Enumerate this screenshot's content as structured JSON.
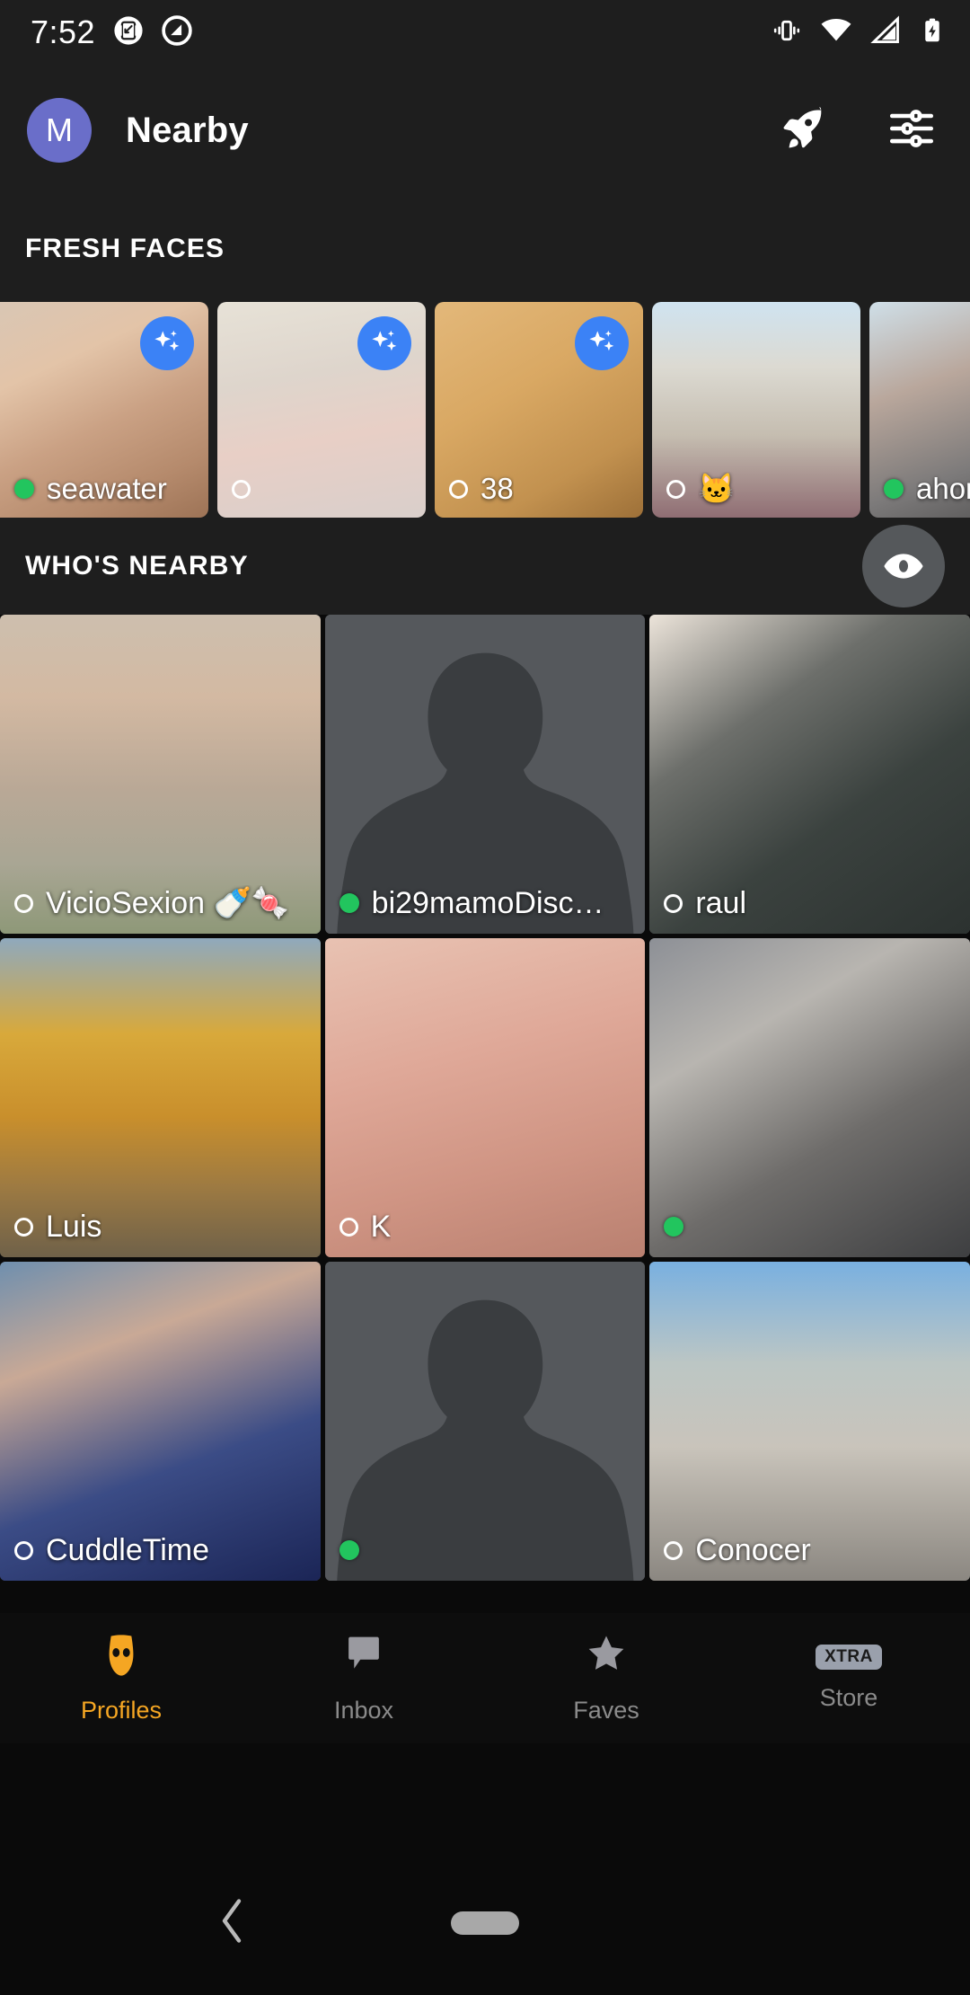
{
  "status_bar": {
    "time": "7:52",
    "left_icons": [
      "screenshot-icon",
      "do-not-disturb-icon"
    ],
    "right_icons": [
      "vibrate-icon",
      "wifi-icon",
      "cellular-signal-icon",
      "battery-charging-icon"
    ]
  },
  "header": {
    "avatar_letter": "M",
    "avatar_color": "#6a6ec9",
    "title": "Nearby",
    "actions": [
      {
        "name": "boost-rocket-button",
        "icon": "rocket-icon"
      },
      {
        "name": "filters-button",
        "icon": "sliders-icon"
      }
    ]
  },
  "fresh_faces": {
    "section_title": "FRESH FACES",
    "cards": [
      {
        "name": "seawater",
        "online": true,
        "new_badge": true,
        "photo": "torso-photo"
      },
      {
        "name": "",
        "online": false,
        "new_badge": true,
        "photo": "blurred-selfie-photo"
      },
      {
        "name": "38",
        "online": false,
        "new_badge": true,
        "photo": "chest-photo"
      },
      {
        "name": "🐱",
        "online": false,
        "new_badge": false,
        "photo": "florence-cathedral-photo"
      },
      {
        "name": "ahora",
        "online": true,
        "new_badge": false,
        "photo": "pixelated-portrait-photo"
      }
    ]
  },
  "whos_nearby": {
    "section_title": "WHO'S NEARBY",
    "eye_button": "visibility-eye-icon",
    "tiles": [
      {
        "name": "VicioSexion 🍼🍬",
        "online": false,
        "photo": "shirtless-torso-photo",
        "placeholder": false
      },
      {
        "name": "bi29mamoDisc…",
        "online": true,
        "photo": "",
        "placeholder": true
      },
      {
        "name": "raul",
        "online": false,
        "photo": "dark-fabric-photo",
        "placeholder": false
      },
      {
        "name": "Luis",
        "online": false,
        "photo": "autumn-park-photo",
        "placeholder": false
      },
      {
        "name": "K",
        "online": false,
        "photo": "bare-chest-photo",
        "placeholder": false
      },
      {
        "name": "",
        "online": true,
        "photo": "pixelated-face-photo",
        "placeholder": false
      },
      {
        "name": "CuddleTime",
        "online": false,
        "photo": "pixelated-portrait-blue-photo",
        "placeholder": false
      },
      {
        "name": "",
        "online": true,
        "photo": "",
        "placeholder": true
      },
      {
        "name": "Conocer",
        "online": false,
        "photo": "vatican-colonnade-photo",
        "placeholder": false
      }
    ]
  },
  "bottom_nav": {
    "items": [
      {
        "label": "Profiles",
        "icon": "grindr-mask-icon",
        "active": true
      },
      {
        "label": "Inbox",
        "icon": "chat-bubble-icon",
        "active": false
      },
      {
        "label": "Faves",
        "icon": "star-icon",
        "active": false
      },
      {
        "label": "Store",
        "icon": "xtra-badge-icon",
        "active": false,
        "badge_text": "XTRA"
      }
    ],
    "active_color": "#f5a623",
    "inactive_color": "#8b8b8b"
  },
  "system_nav": {
    "back": "back-chevron-icon",
    "home": "home-pill-icon"
  }
}
